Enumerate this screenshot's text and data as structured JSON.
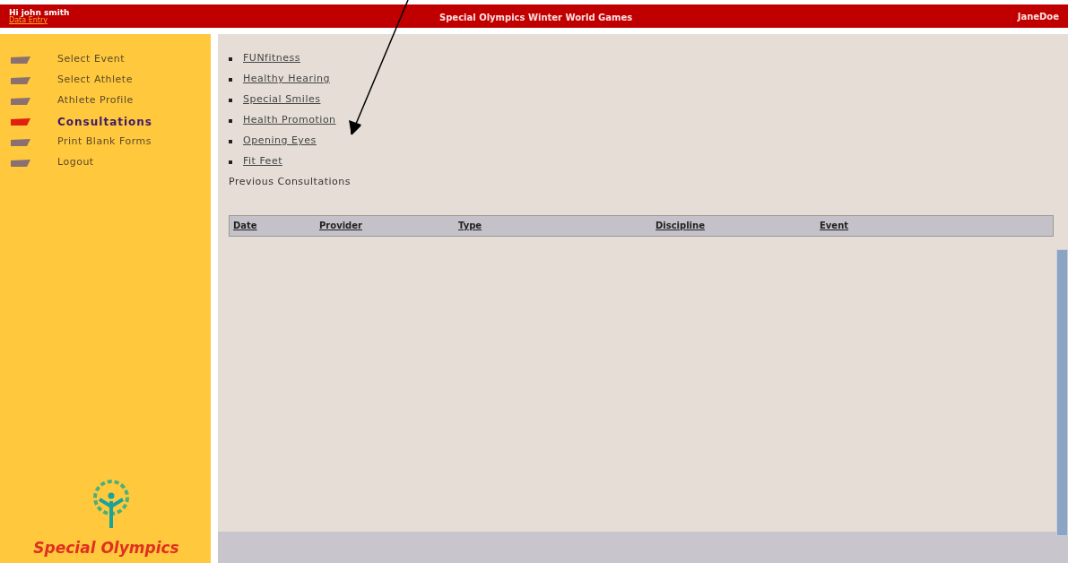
{
  "header": {
    "greeting": "Hi john smith",
    "subtitle": "Data Entry",
    "title": "Special Olympics Winter World Games",
    "user": "JaneDoe"
  },
  "sidebar": {
    "items": [
      {
        "label": "Select Event",
        "selected": false
      },
      {
        "label": "Select Athlete",
        "selected": false
      },
      {
        "label": "Athlete Profile",
        "selected": false
      },
      {
        "label": "Consultations",
        "selected": true
      },
      {
        "label": "Print Blank Forms",
        "selected": false
      },
      {
        "label": "Logout",
        "selected": false
      }
    ],
    "logo_text": "Special Olympics"
  },
  "links": [
    "FUNfitness",
    "Healthy Hearing",
    "Special Smiles",
    "Health Promotion",
    "Opening Eyes",
    "Fit Feet"
  ],
  "section_title": "Previous Consultations",
  "table": {
    "columns": [
      "Date",
      "Provider",
      "Type",
      "Discipline",
      "Event"
    ]
  }
}
